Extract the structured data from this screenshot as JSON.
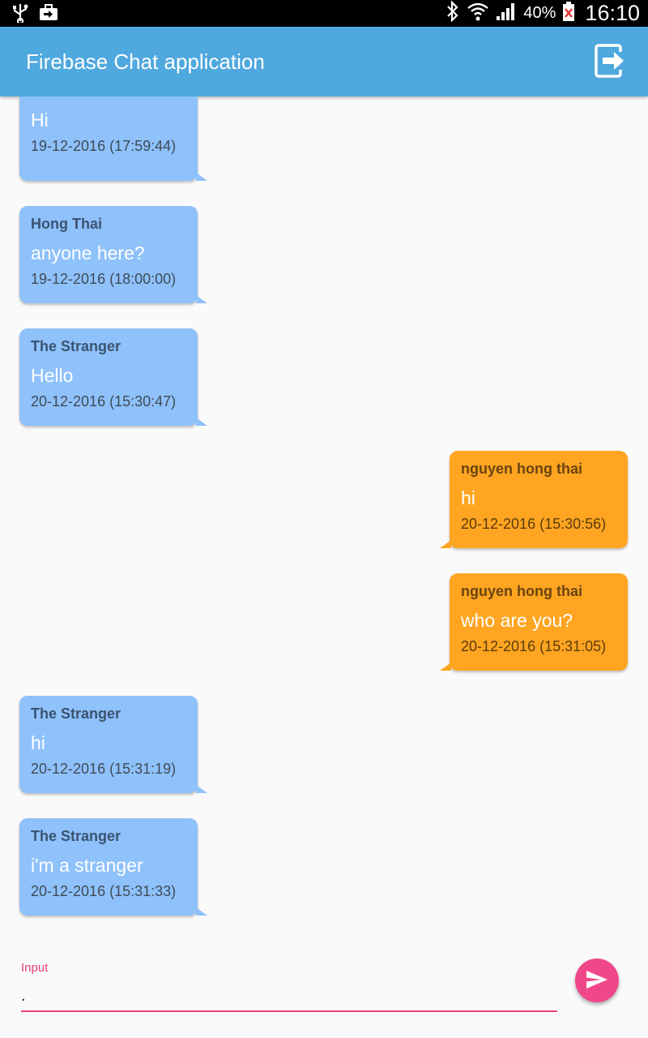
{
  "status_bar": {
    "battery_percent": "40%",
    "time": "16:10",
    "icons": [
      "usb-icon",
      "briefcase-icon",
      "bluetooth-icon",
      "wifi-icon",
      "signal-icon",
      "battery-icon"
    ]
  },
  "app_bar": {
    "title": "Firebase Chat application",
    "action_icon": "logout-icon",
    "color": "#4fa8de"
  },
  "messages": [
    {
      "sender": "",
      "text": "Hi",
      "time": "19-12-2016 (17:59:44)",
      "direction": "incoming"
    },
    {
      "sender": "Hong Thai",
      "text": "anyone here?",
      "time": "19-12-2016 (18:00:00)",
      "direction": "incoming"
    },
    {
      "sender": "The Stranger",
      "text": "Hello",
      "time": "20-12-2016 (15:30:47)",
      "direction": "incoming"
    },
    {
      "sender": "nguyen hong thai",
      "text": "hi",
      "time": "20-12-2016 (15:30:56)",
      "direction": "outgoing"
    },
    {
      "sender": "nguyen hong thai",
      "text": "who are you?",
      "time": "20-12-2016 (15:31:05)",
      "direction": "outgoing"
    },
    {
      "sender": "The Stranger",
      "text": "hi",
      "time": "20-12-2016 (15:31:19)",
      "direction": "incoming"
    },
    {
      "sender": "The Stranger",
      "text": "i'm a stranger",
      "time": "20-12-2016 (15:31:33)",
      "direction": "incoming"
    }
  ],
  "colors": {
    "incoming_bubble": "#8fc1fb",
    "outgoing_bubble": "#ffa521",
    "accent": "#f0468a"
  },
  "composer": {
    "label": "Input",
    "value": ".",
    "send_icon": "send-icon"
  }
}
